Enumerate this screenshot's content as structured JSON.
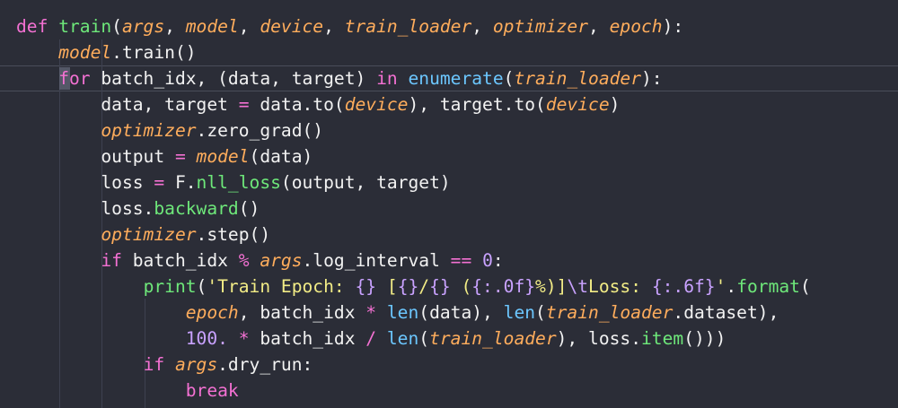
{
  "editor": {
    "lines": [
      {
        "tokens": [
          {
            "t": "def ",
            "c": "kw"
          },
          {
            "t": "train",
            "c": "fn"
          },
          {
            "t": "(",
            "c": "pl"
          },
          {
            "t": "args",
            "c": "par"
          },
          {
            "t": ", ",
            "c": "pl"
          },
          {
            "t": "model",
            "c": "par"
          },
          {
            "t": ", ",
            "c": "pl"
          },
          {
            "t": "device",
            "c": "par"
          },
          {
            "t": ", ",
            "c": "pl"
          },
          {
            "t": "train_loader",
            "c": "par"
          },
          {
            "t": ", ",
            "c": "pl"
          },
          {
            "t": "optimizer",
            "c": "par"
          },
          {
            "t": ", ",
            "c": "pl"
          },
          {
            "t": "epoch",
            "c": "par"
          },
          {
            "t": "):",
            "c": "pl"
          }
        ]
      },
      {
        "tokens": [
          {
            "t": "    ",
            "c": "pl"
          },
          {
            "t": "model",
            "c": "par"
          },
          {
            "t": ".train()",
            "c": "pl"
          }
        ]
      },
      {
        "tokens": [
          {
            "t": "    ",
            "c": "pl"
          },
          {
            "t": "for",
            "c": "kw"
          },
          {
            "t": " batch_idx, (data, target) ",
            "c": "pl"
          },
          {
            "t": "in",
            "c": "kw"
          },
          {
            "t": " ",
            "c": "pl"
          },
          {
            "t": "enumerate",
            "c": "bi"
          },
          {
            "t": "(",
            "c": "pl"
          },
          {
            "t": "train_loader",
            "c": "par"
          },
          {
            "t": "):",
            "c": "pl"
          }
        ]
      },
      {
        "tokens": [
          {
            "t": "        data, target ",
            "c": "pl"
          },
          {
            "t": "=",
            "c": "op"
          },
          {
            "t": " data.to(",
            "c": "pl"
          },
          {
            "t": "device",
            "c": "par"
          },
          {
            "t": "), target.to(",
            "c": "pl"
          },
          {
            "t": "device",
            "c": "par"
          },
          {
            "t": ")",
            "c": "pl"
          }
        ]
      },
      {
        "tokens": [
          {
            "t": "        ",
            "c": "pl"
          },
          {
            "t": "optimizer",
            "c": "par"
          },
          {
            "t": ".zero_grad()",
            "c": "pl"
          }
        ]
      },
      {
        "tokens": [
          {
            "t": "        output ",
            "c": "pl"
          },
          {
            "t": "=",
            "c": "op"
          },
          {
            "t": " ",
            "c": "pl"
          },
          {
            "t": "model",
            "c": "par"
          },
          {
            "t": "(data)",
            "c": "pl"
          }
        ]
      },
      {
        "tokens": [
          {
            "t": "        loss ",
            "c": "pl"
          },
          {
            "t": "=",
            "c": "op"
          },
          {
            "t": " F.",
            "c": "pl"
          },
          {
            "t": "nll_loss",
            "c": "fn"
          },
          {
            "t": "(output, target)",
            "c": "pl"
          }
        ]
      },
      {
        "tokens": [
          {
            "t": "        loss.",
            "c": "pl"
          },
          {
            "t": "backward",
            "c": "fn"
          },
          {
            "t": "()",
            "c": "pl"
          }
        ]
      },
      {
        "tokens": [
          {
            "t": "        ",
            "c": "pl"
          },
          {
            "t": "optimizer",
            "c": "par"
          },
          {
            "t": ".step()",
            "c": "pl"
          }
        ]
      },
      {
        "tokens": [
          {
            "t": "        ",
            "c": "pl"
          },
          {
            "t": "if",
            "c": "kw"
          },
          {
            "t": " batch_idx ",
            "c": "pl"
          },
          {
            "t": "%",
            "c": "op"
          },
          {
            "t": " ",
            "c": "pl"
          },
          {
            "t": "args",
            "c": "par"
          },
          {
            "t": ".log_interval ",
            "c": "pl"
          },
          {
            "t": "==",
            "c": "op"
          },
          {
            "t": " ",
            "c": "pl"
          },
          {
            "t": "0",
            "c": "num"
          },
          {
            "t": ":",
            "c": "pl"
          }
        ]
      },
      {
        "tokens": [
          {
            "t": "            ",
            "c": "pl"
          },
          {
            "t": "print",
            "c": "fn"
          },
          {
            "t": "(",
            "c": "pl"
          },
          {
            "t": "'Train Epoch: ",
            "c": "str"
          },
          {
            "t": "{}",
            "c": "num"
          },
          {
            "t": " [",
            "c": "str"
          },
          {
            "t": "{}",
            "c": "num"
          },
          {
            "t": "/",
            "c": "str"
          },
          {
            "t": "{}",
            "c": "num"
          },
          {
            "t": " (",
            "c": "str"
          },
          {
            "t": "{:.0f}",
            "c": "num"
          },
          {
            "t": "%)]",
            "c": "str"
          },
          {
            "t": "\\t",
            "c": "num"
          },
          {
            "t": "Loss: ",
            "c": "str"
          },
          {
            "t": "{:.6f}",
            "c": "num"
          },
          {
            "t": "'",
            "c": "str"
          },
          {
            "t": ".",
            "c": "pl"
          },
          {
            "t": "format",
            "c": "fn"
          },
          {
            "t": "(",
            "c": "pl"
          }
        ]
      },
      {
        "tokens": [
          {
            "t": "                ",
            "c": "pl"
          },
          {
            "t": "epoch",
            "c": "par"
          },
          {
            "t": ", batch_idx ",
            "c": "pl"
          },
          {
            "t": "*",
            "c": "op"
          },
          {
            "t": " ",
            "c": "pl"
          },
          {
            "t": "len",
            "c": "bi"
          },
          {
            "t": "(data), ",
            "c": "pl"
          },
          {
            "t": "len",
            "c": "bi"
          },
          {
            "t": "(",
            "c": "pl"
          },
          {
            "t": "train_loader",
            "c": "par"
          },
          {
            "t": ".dataset),",
            "c": "pl"
          }
        ]
      },
      {
        "tokens": [
          {
            "t": "                ",
            "c": "pl"
          },
          {
            "t": "100.",
            "c": "num"
          },
          {
            "t": " ",
            "c": "pl"
          },
          {
            "t": "*",
            "c": "op"
          },
          {
            "t": " batch_idx ",
            "c": "pl"
          },
          {
            "t": "/",
            "c": "op"
          },
          {
            "t": " ",
            "c": "pl"
          },
          {
            "t": "len",
            "c": "bi"
          },
          {
            "t": "(",
            "c": "pl"
          },
          {
            "t": "train_loader",
            "c": "par"
          },
          {
            "t": "), loss.",
            "c": "pl"
          },
          {
            "t": "item",
            "c": "fn"
          },
          {
            "t": "()))",
            "c": "pl"
          }
        ]
      },
      {
        "tokens": [
          {
            "t": "            ",
            "c": "pl"
          },
          {
            "t": "if",
            "c": "kw"
          },
          {
            "t": " ",
            "c": "pl"
          },
          {
            "t": "args",
            "c": "par"
          },
          {
            "t": ".dry_run:",
            "c": "pl"
          }
        ]
      },
      {
        "tokens": [
          {
            "t": "                ",
            "c": "pl"
          },
          {
            "t": "break",
            "c": "kw"
          }
        ]
      }
    ]
  },
  "colors": {
    "background": "#2b2d37",
    "keyword": "#f471d3",
    "function": "#6ee87a",
    "parameter": "#ffad5c",
    "number": "#c9a2ff",
    "string": "#f2ec86",
    "builtin": "#6cc7ff",
    "plain": "#f2f2f2"
  }
}
